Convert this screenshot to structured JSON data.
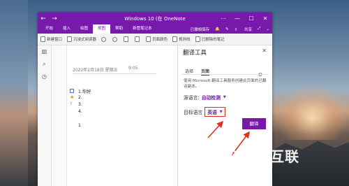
{
  "window": {
    "title": "Windows 10 (在 OneNote",
    "back_icon": "arrow-left",
    "forward_icon": "arrow-right",
    "controls": [
      "⋯",
      "—",
      "☐",
      "✕"
    ]
  },
  "menu": {
    "tabs": [
      "开始",
      "插入",
      "绘图",
      "视图",
      "帮助",
      "新管笔记本"
    ],
    "active_tab": "视图",
    "saved_status": "已撤相保存",
    "share_label": "共享",
    "ribbon": {
      "new_window": "新建窗口",
      "immersive_reader": "沉浸式阅读器",
      "page_color": "页面颜色",
      "rule_lines": "规则线",
      "deleted_notes": "已删除的笔记"
    }
  },
  "page": {
    "date": "2022年2月18日 星期五",
    "time": "9:05",
    "items": [
      "1.你好",
      "2.",
      "3.",
      "4.",
      "1"
    ]
  },
  "translator": {
    "title": "翻译工具",
    "tab_selection": "选择",
    "tab_page": "页面",
    "description": "使用 Microsoft 翻译工具服务创建此页面的已翻译副本。",
    "source_label": "源语言:",
    "source_value": "自动检测",
    "target_label": "目标语言",
    "target_value": "英语",
    "translate_button": "翻译"
  },
  "colors": {
    "brand": "#7719aa",
    "highlight_box": "#e0301e",
    "arrow": "#e0301e"
  },
  "watermark": {
    "text": "自由互联"
  }
}
